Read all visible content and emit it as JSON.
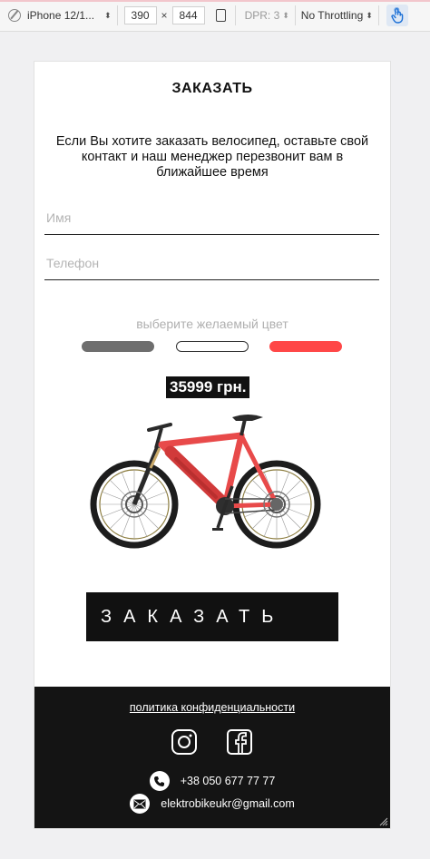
{
  "devtools": {
    "device": "iPhone 12/1...",
    "width": "390",
    "times": "×",
    "height": "844",
    "dpr": "DPR: 3",
    "throttling": "No Throttling"
  },
  "page": {
    "title": "ЗАКАЗАТЬ",
    "intro": "Если Вы хотите заказать велосипед, оставьте свой контакт и наш менеджер перезвонит вам в ближайшее время",
    "name_placeholder": "Имя",
    "phone_placeholder": "Телефон",
    "color_label": "выберите желаемый цвет",
    "colors": [
      "#6e6e6e",
      "#ffffff",
      "#ff4747"
    ],
    "price": "35999 грн.",
    "order_button": "ЗАКАЗАТЬ"
  },
  "footer": {
    "policy": "политика конфиденциальности",
    "phone": "+38 050 677 77 77",
    "email": "elektrobikeukr@gmail.com"
  }
}
